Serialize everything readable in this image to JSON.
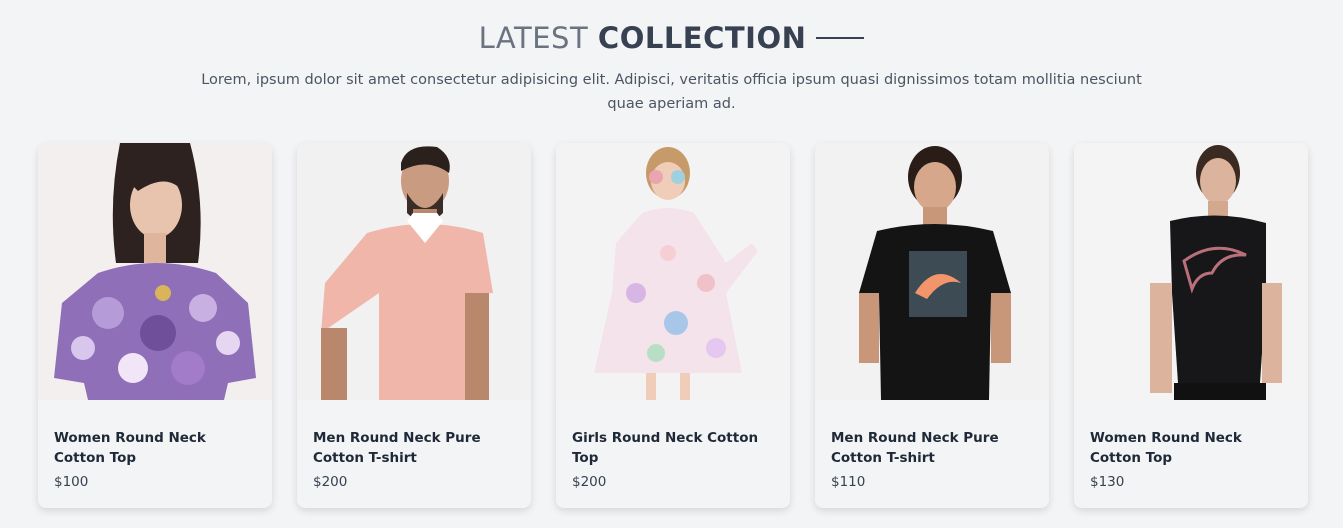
{
  "header": {
    "title_light": "LATEST",
    "title_bold": "COLLECTION",
    "subtitle": "Lorem, ipsum dolor sit amet consectetur adipisicing elit. Adipisci, veritatis officia ipsum quasi dignissimos totam mollitia nesciunt quae aperiam ad."
  },
  "products": [
    {
      "name": "Women Round Neck Cotton Top",
      "price": "$100",
      "image": "woman-floral-top-photo"
    },
    {
      "name": "Men Round Neck Pure Cotton T-shirt",
      "price": "$200",
      "image": "man-pink-polo-photo"
    },
    {
      "name": "Girls Round Neck Cotton Top",
      "price": "$200",
      "image": "girl-floral-dress-photo"
    },
    {
      "name": "Men Round Neck Pure Cotton T-shirt",
      "price": "$110",
      "image": "man-black-tshirt-photo"
    },
    {
      "name": "Women Round Neck Cotton Top",
      "price": "$130",
      "image": "woman-black-tshirt-photo"
    }
  ]
}
